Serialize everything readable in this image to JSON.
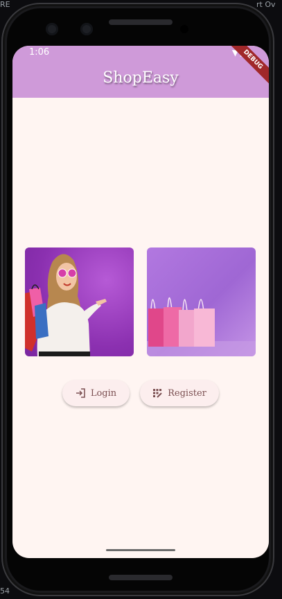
{
  "status_bar": {
    "time": "1:06"
  },
  "app_bar": {
    "title": "ShopEasy",
    "debug_banner": "DEBUG"
  },
  "buttons": {
    "login_label": "Login",
    "register_label": "Register"
  },
  "side_text": {
    "top_left": "RE",
    "top_right": "rt Ov",
    "bottom_left": "54"
  },
  "colors": {
    "app_bar": "#cf9ad9",
    "background": "#fff5f2",
    "button_bg": "#fceeee",
    "button_text": "#7a4e50"
  }
}
